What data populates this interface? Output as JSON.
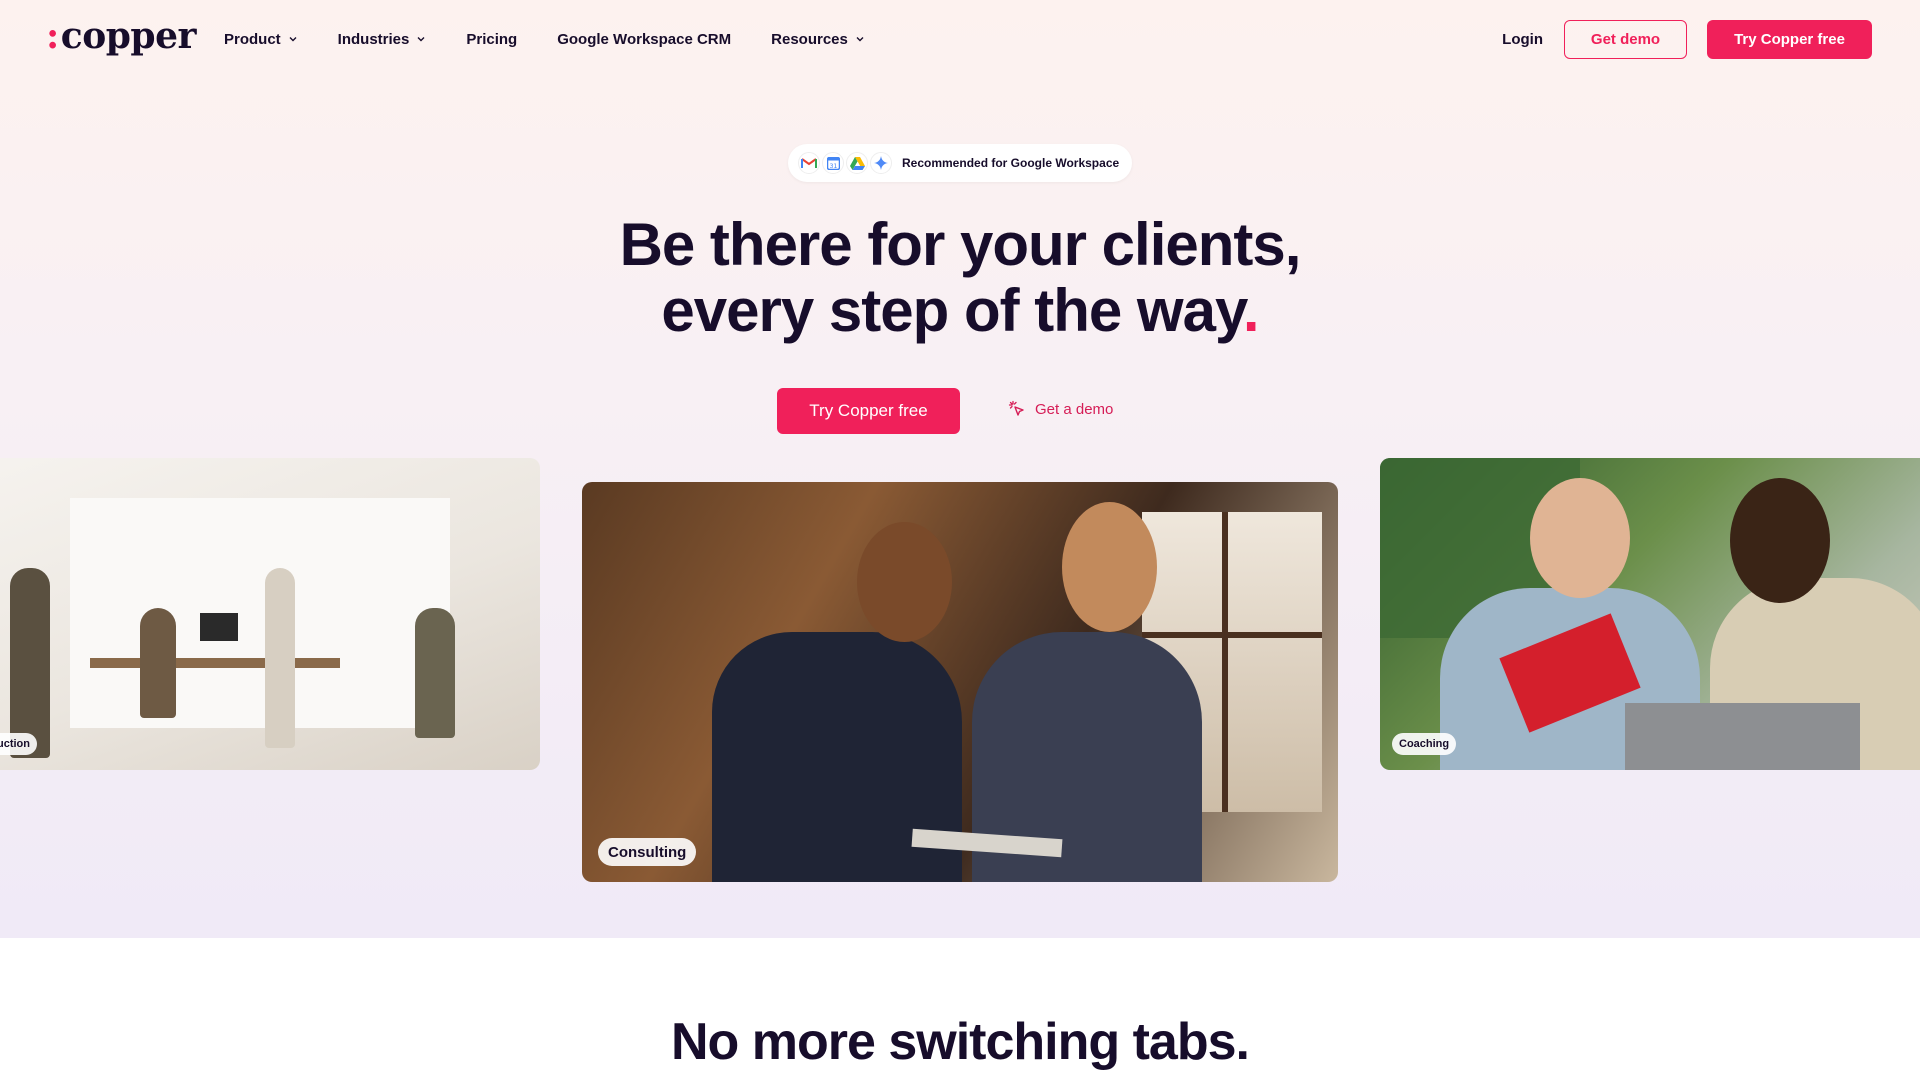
{
  "brand": {
    "name": "copper",
    "dot": ":"
  },
  "nav": {
    "items": [
      {
        "label": "Product",
        "dropdown": true
      },
      {
        "label": "Industries",
        "dropdown": true
      },
      {
        "label": "Pricing",
        "dropdown": false
      },
      {
        "label": "Google Workspace CRM",
        "dropdown": false
      },
      {
        "label": "Resources",
        "dropdown": true
      }
    ],
    "login": "Login",
    "get_demo": "Get demo",
    "try_free": "Try Copper free"
  },
  "badge": {
    "text": "Recommended for Google Workspace",
    "icons": [
      "gmail-icon",
      "google-calendar-icon",
      "google-drive-icon",
      "gemini-icon"
    ]
  },
  "hero": {
    "line1": "Be there for your clients,",
    "line2": "every step of the way",
    "dot": ".",
    "cta_primary": "Try Copper free",
    "cta_secondary": "Get a demo"
  },
  "cards": {
    "left_tag": "uction",
    "center_tag": "Consulting",
    "right_tag": "Coaching"
  },
  "section2": {
    "title": "No more switching tabs."
  },
  "colors": {
    "accent": "#f0205a",
    "text": "#170d2b"
  }
}
